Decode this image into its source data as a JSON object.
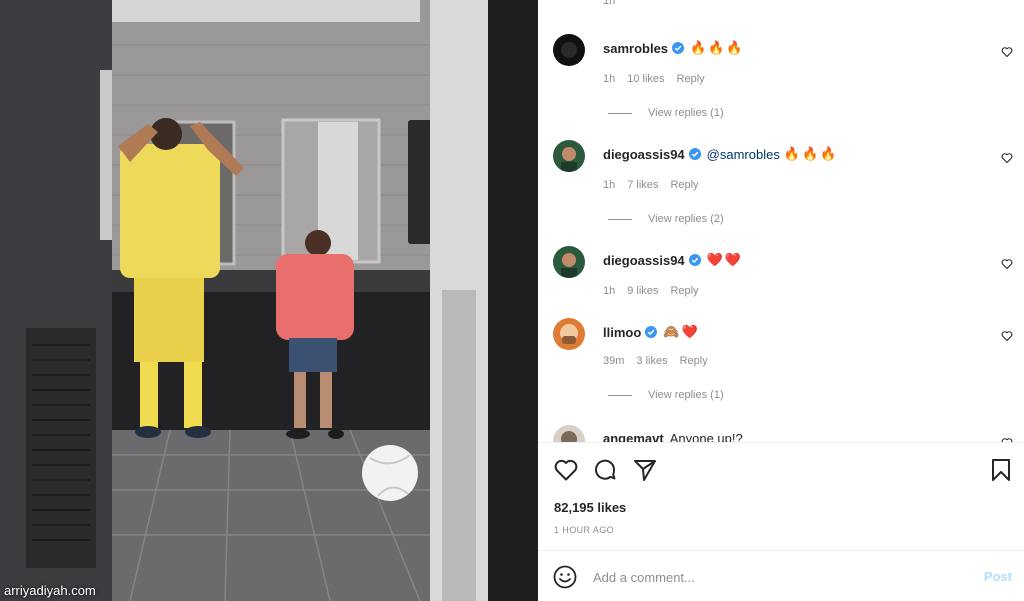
{
  "watermark": "arriyadiyah.com",
  "post": {
    "top_time": "1h",
    "comments": [
      {
        "username": "samrobles",
        "verified": true,
        "mention": "",
        "text": "",
        "emoji": [
          "🔥",
          "🔥",
          "🔥"
        ],
        "time": "1h",
        "likes": "10 likes",
        "reply_label": "Reply",
        "view_replies": "View replies (1)",
        "avatar_color": "#111111"
      },
      {
        "username": "diegoassis94",
        "verified": true,
        "mention": "@samrobles",
        "text": "",
        "emoji": [
          "🔥",
          "🔥",
          "🔥"
        ],
        "time": "1h",
        "likes": "7 likes",
        "reply_label": "Reply",
        "view_replies": "View replies (2)",
        "avatar_color": "#2d5a3c"
      },
      {
        "username": "diegoassis94",
        "verified": true,
        "mention": "",
        "text": "",
        "emoji": [
          "❤️",
          "❤️"
        ],
        "time": "1h",
        "likes": "9 likes",
        "reply_label": "Reply",
        "view_replies": "",
        "avatar_color": "#2d5a3c"
      },
      {
        "username": "llimoo",
        "verified": true,
        "mention": "",
        "text": "",
        "emoji": [
          "🙈",
          "❤️"
        ],
        "time": "39m",
        "likes": "3 likes",
        "reply_label": "Reply",
        "view_replies": "View replies (1)",
        "avatar_color": "#e07b35"
      },
      {
        "username": "angemavt",
        "verified": false,
        "mention": "",
        "text": "Anyone up!?",
        "emoji": [],
        "time": "",
        "likes": "",
        "reply_label": "",
        "view_replies": "",
        "avatar_color": "#7a6a5a"
      }
    ],
    "likes_count": "82,195 likes",
    "time_ago": "1 HOUR AGO",
    "add_comment_placeholder": "Add a comment...",
    "post_button": "Post"
  },
  "icons": {
    "like": "heart-icon",
    "comment": "comment-icon",
    "share": "paper-plane-icon",
    "save": "bookmark-icon",
    "emoji": "smiley-icon",
    "verified": "verified-badge-icon"
  },
  "colors": {
    "verified": "#3897f0",
    "post_disabled": "#b2dffc",
    "mention": "#00376b",
    "muted": "#8e8e8e"
  }
}
